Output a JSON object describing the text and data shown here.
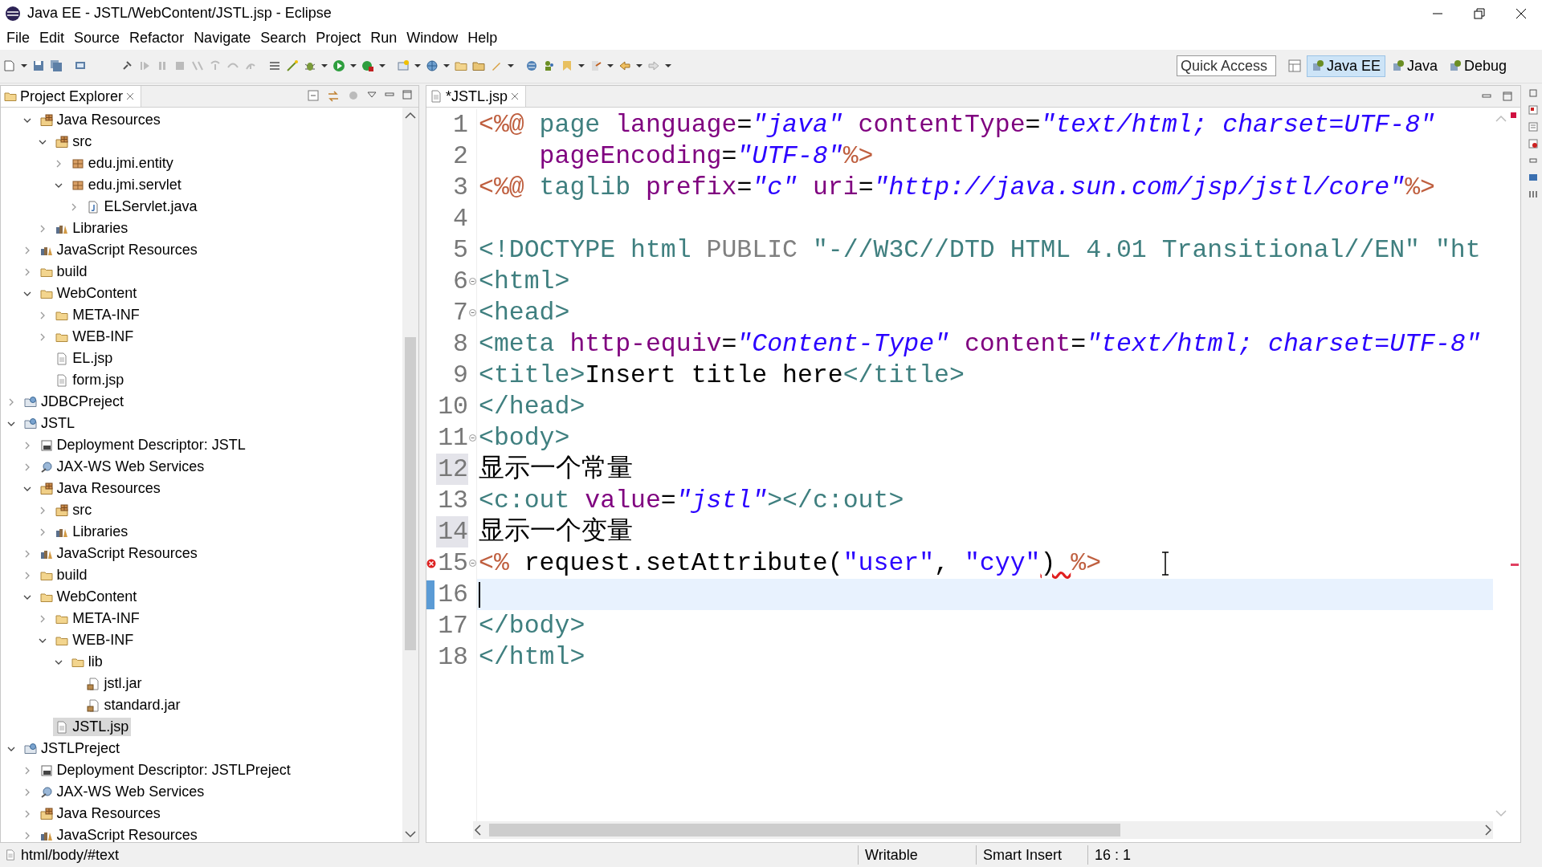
{
  "window": {
    "title": "Java EE - JSTL/WebContent/JSTL.jsp - Eclipse"
  },
  "menu": [
    "File",
    "Edit",
    "Source",
    "Refactor",
    "Navigate",
    "Search",
    "Project",
    "Run",
    "Window",
    "Help"
  ],
  "quick_access": {
    "placeholder": "Quick Access"
  },
  "perspectives": [
    {
      "label": "Java EE",
      "selected": true
    },
    {
      "label": "Java",
      "selected": false
    },
    {
      "label": "Debug",
      "selected": false
    }
  ],
  "explorer": {
    "title": "Project Explorer",
    "items": [
      {
        "children": [
          {
            "label": "Java Resources",
            "kind": "java-resources",
            "expanded": true,
            "selected": false,
            "children": [
              {
                "label": "src",
                "kind": "source-folder",
                "expanded": true,
                "selected": false,
                "children": [
                  {
                    "label": "edu.jmi.entity",
                    "kind": "package",
                    "expanded": false,
                    "selected": false
                  },
                  {
                    "label": "edu.jmi.servlet",
                    "kind": "package",
                    "expanded": true,
                    "selected": false,
                    "children": [
                      {
                        "label": "ELServlet.java",
                        "kind": "java-file",
                        "expanded": false,
                        "selected": false
                      }
                    ]
                  }
                ]
              },
              {
                "label": "Libraries",
                "kind": "library",
                "expanded": false,
                "selected": false
              }
            ]
          },
          {
            "label": "JavaScript Resources",
            "kind": "library",
            "expanded": false,
            "selected": false
          },
          {
            "label": "build",
            "kind": "folder",
            "expanded": false,
            "selected": false
          },
          {
            "label": "WebContent",
            "kind": "folder",
            "expanded": true,
            "selected": false,
            "children": [
              {
                "label": "META-INF",
                "kind": "folder",
                "expanded": false,
                "selected": false
              },
              {
                "label": "WEB-INF",
                "kind": "folder",
                "expanded": false,
                "selected": false
              },
              {
                "label": "EL.jsp",
                "kind": "file",
                "selected": false
              },
              {
                "label": "form.jsp",
                "kind": "file",
                "selected": false
              }
            ]
          }
        ]
      },
      {
        "label": "JDBCPreject",
        "kind": "project",
        "expanded": false,
        "selected": false
      },
      {
        "label": "JSTL",
        "kind": "project",
        "expanded": true,
        "selected": false,
        "children": [
          {
            "label": "Deployment Descriptor: JSTL",
            "kind": "descriptor",
            "expanded": false,
            "selected": false
          },
          {
            "label": "JAX-WS Web Services",
            "kind": "web-services",
            "expanded": false,
            "selected": false
          },
          {
            "label": "Java Resources",
            "kind": "java-resources",
            "expanded": true,
            "selected": false,
            "children": [
              {
                "label": "src",
                "kind": "source-folder",
                "expanded": false,
                "selected": false
              },
              {
                "label": "Libraries",
                "kind": "library",
                "expanded": false,
                "selected": false
              }
            ]
          },
          {
            "label": "JavaScript Resources",
            "kind": "library",
            "expanded": false,
            "selected": false
          },
          {
            "label": "build",
            "kind": "folder",
            "expanded": false,
            "selected": false
          },
          {
            "label": "WebContent",
            "kind": "folder",
            "expanded": true,
            "selected": false,
            "children": [
              {
                "label": "META-INF",
                "kind": "folder",
                "expanded": false,
                "selected": false
              },
              {
                "label": "WEB-INF",
                "kind": "folder",
                "expanded": true,
                "selected": false,
                "children": [
                  {
                    "label": "lib",
                    "kind": "folder",
                    "expanded": true,
                    "selected": false,
                    "children": [
                      {
                        "label": "jstl.jar",
                        "kind": "jar",
                        "selected": false
                      },
                      {
                        "label": "standard.jar",
                        "kind": "jar",
                        "selected": false
                      }
                    ]
                  }
                ]
              },
              {
                "label": "JSTL.jsp",
                "kind": "file",
                "selected": true
              }
            ]
          }
        ]
      },
      {
        "label": "JSTLPreject",
        "kind": "project",
        "expanded": true,
        "selected": false,
        "children": [
          {
            "label": "Deployment Descriptor: JSTLPreject",
            "kind": "descriptor",
            "expanded": false,
            "selected": false
          },
          {
            "label": "JAX-WS Web Services",
            "kind": "web-services",
            "expanded": false,
            "selected": false
          },
          {
            "label": "Java Resources",
            "kind": "java-resources",
            "expanded": false,
            "selected": false
          },
          {
            "label": "JavaScript Resources",
            "kind": "library",
            "expanded": false,
            "selected": false
          }
        ]
      }
    ]
  },
  "editor": {
    "tab": "*JSTL.jsp",
    "lines": [
      {
        "number": "1",
        "foldable": false,
        "error": false,
        "current": false,
        "marked": false,
        "tokens": [
          {
            "kind": "delim",
            "text": "<%@"
          },
          {
            "kind": "directive",
            "text": " page"
          },
          {
            "kind": "attr",
            "text": " language"
          },
          {
            "kind": "plain",
            "text": "="
          },
          {
            "kind": "value",
            "text": "\"java\""
          },
          {
            "kind": "attr",
            "text": " contentType"
          },
          {
            "kind": "plain",
            "text": "="
          },
          {
            "kind": "value",
            "text": "\"text/html; charset=UTF-8\""
          }
        ]
      },
      {
        "number": "2",
        "foldable": false,
        "error": false,
        "current": false,
        "marked": false,
        "tokens": [
          {
            "kind": "attr",
            "text": "    pageEncoding"
          },
          {
            "kind": "plain",
            "text": "="
          },
          {
            "kind": "value",
            "text": "\"UTF-8\""
          },
          {
            "kind": "delim",
            "text": "%>"
          }
        ]
      },
      {
        "number": "3",
        "foldable": false,
        "error": false,
        "current": false,
        "marked": false,
        "tokens": [
          {
            "kind": "delim",
            "text": "<%@"
          },
          {
            "kind": "directive",
            "text": " taglib"
          },
          {
            "kind": "attr",
            "text": " prefix"
          },
          {
            "kind": "plain",
            "text": "="
          },
          {
            "kind": "value",
            "text": "\"c\""
          },
          {
            "kind": "attr",
            "text": " uri"
          },
          {
            "kind": "plain",
            "text": "="
          },
          {
            "kind": "value",
            "text": "\"http://java.sun.com/jsp/jstl/core\""
          },
          {
            "kind": "delim",
            "text": "%>"
          }
        ]
      },
      {
        "number": "4",
        "foldable": false,
        "error": false,
        "current": false,
        "marked": false
      },
      {
        "number": "5",
        "foldable": false,
        "error": false,
        "current": false,
        "marked": false,
        "tokens": [
          {
            "kind": "tag",
            "text": "<!DOCTYPE html"
          },
          {
            "kind": "keyword",
            "text": " PUBLIC"
          },
          {
            "kind": "doctype",
            "text": " \"-//W3C//DTD HTML 4.01 Transitional//EN\""
          },
          {
            "kind": "doctype",
            "text": " \"ht"
          }
        ]
      },
      {
        "number": "6",
        "foldable": true,
        "error": false,
        "current": false,
        "marked": false,
        "tokens": [
          {
            "kind": "tag",
            "text": "<html>"
          }
        ]
      },
      {
        "number": "7",
        "foldable": true,
        "error": false,
        "current": false,
        "marked": false,
        "tokens": [
          {
            "kind": "tag",
            "text": "<head>"
          }
        ]
      },
      {
        "number": "8",
        "foldable": false,
        "error": false,
        "current": false,
        "marked": false,
        "tokens": [
          {
            "kind": "tag",
            "text": "<meta"
          },
          {
            "kind": "attr",
            "text": " http-equiv"
          },
          {
            "kind": "plain",
            "text": "="
          },
          {
            "kind": "value",
            "text": "\"Content-Type\""
          },
          {
            "kind": "attr",
            "text": " content"
          },
          {
            "kind": "plain",
            "text": "="
          },
          {
            "kind": "value",
            "text": "\"text/html; charset=UTF-8\""
          }
        ]
      },
      {
        "number": "9",
        "foldable": false,
        "error": false,
        "current": false,
        "marked": false,
        "tokens": [
          {
            "kind": "tag",
            "text": "<title>"
          },
          {
            "kind": "plain",
            "text": "Insert title here"
          },
          {
            "kind": "tag",
            "text": "</title>"
          }
        ]
      },
      {
        "number": "10",
        "foldable": false,
        "error": false,
        "current": false,
        "marked": false,
        "tokens": [
          {
            "kind": "tag",
            "text": "</head>"
          }
        ]
      },
      {
        "number": "11",
        "foldable": true,
        "error": false,
        "current": false,
        "marked": false,
        "tokens": [
          {
            "kind": "tag",
            "text": "<body>"
          }
        ]
      },
      {
        "number": "12",
        "foldable": false,
        "error": false,
        "current": false,
        "marked": true,
        "tokens": [
          {
            "kind": "plain",
            "text": "显示一个常量"
          }
        ]
      },
      {
        "number": "13",
        "foldable": false,
        "error": false,
        "current": false,
        "marked": false,
        "tokens": [
          {
            "kind": "tag",
            "text": "<c:out"
          },
          {
            "kind": "attr",
            "text": " value"
          },
          {
            "kind": "plain",
            "text": "="
          },
          {
            "kind": "value",
            "text": "\"jstl\""
          },
          {
            "kind": "tag",
            "text": "></c:out>"
          }
        ]
      },
      {
        "number": "14",
        "foldable": false,
        "error": false,
        "current": false,
        "marked": true,
        "tokens": [
          {
            "kind": "plain",
            "text": "显示一个变量"
          }
        ]
      },
      {
        "number": "15",
        "foldable": true,
        "error": true,
        "current": false,
        "marked": false,
        "tokens": [
          {
            "kind": "delim",
            "text": "<%"
          },
          {
            "kind": "plain",
            "text": " request.setAttribute("
          },
          {
            "kind": "string",
            "text": "\"user\""
          },
          {
            "kind": "plain",
            "text": ", "
          },
          {
            "kind": "string",
            "text": "\"cyy\""
          },
          {
            "kind": "error",
            "text": ") "
          },
          {
            "kind": "delim",
            "text": "%>"
          }
        ]
      },
      {
        "number": "16",
        "foldable": false,
        "error": false,
        "current": true,
        "marked": false
      },
      {
        "number": "17",
        "foldable": false,
        "error": false,
        "current": false,
        "marked": false,
        "tokens": [
          {
            "kind": "tag",
            "text": "</body>"
          }
        ]
      },
      {
        "number": "18",
        "foldable": false,
        "error": false,
        "current": false,
        "marked": false,
        "tokens": [
          {
            "kind": "tag",
            "text": "</html>"
          }
        ]
      }
    ]
  },
  "status_bar": {
    "path": "html/body/#text",
    "mode": "Writable",
    "insert_mode": "Smart Insert",
    "position": "16 : 1"
  }
}
